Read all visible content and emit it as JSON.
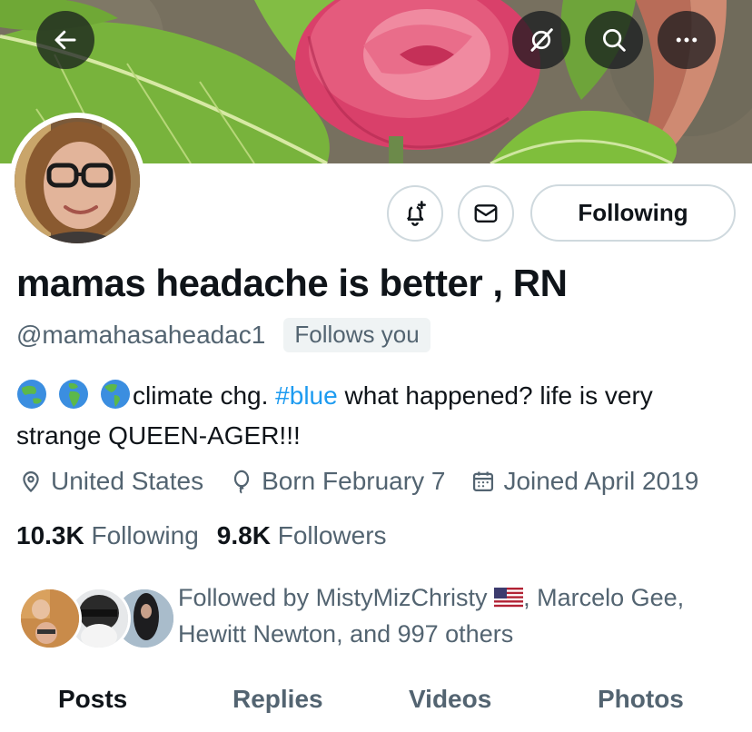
{
  "header": {
    "back_icon": "arrow-left-icon",
    "grok_icon": "grok-icon",
    "search_icon": "search-icon",
    "more_icon": "more-horizontal-icon"
  },
  "profile": {
    "display_name": "mamas headache is better , RN",
    "handle": "@mamahasaheadac1",
    "follows_you_badge": "Follows you",
    "bio": {
      "emojis": [
        "globe-asia-australia",
        "globe-europe-africa",
        "globe-americas"
      ],
      "text_before_hashtag": "climate chg. ",
      "hashtag": "#blue",
      "text_after_hashtag": " what happened? life is very strange QUEEN-AGER!!!"
    },
    "location": "United States",
    "birthday": "Born February 7",
    "joined": "Joined April 2019",
    "following_count": "10.3K",
    "following_label": "Following",
    "followers_count": "9.8K",
    "followers_label": "Followers"
  },
  "actions": {
    "notify_icon": "bell-plus-icon",
    "message_icon": "envelope-icon",
    "following_button": "Following"
  },
  "followed_by": {
    "prefix": "Followed by MistyMizChristy",
    "flag": "us-flag",
    "suffix": ", Marcelo Gee, Hewitt Newton, and 997 others"
  },
  "tabs": [
    "Posts",
    "Replies",
    "Videos",
    "Photos"
  ],
  "active_tab": "Posts",
  "colors": {
    "accent": "#1d9bf0",
    "text_primary": "#0f1419",
    "text_secondary": "#536471",
    "border": "#cfd9de"
  }
}
